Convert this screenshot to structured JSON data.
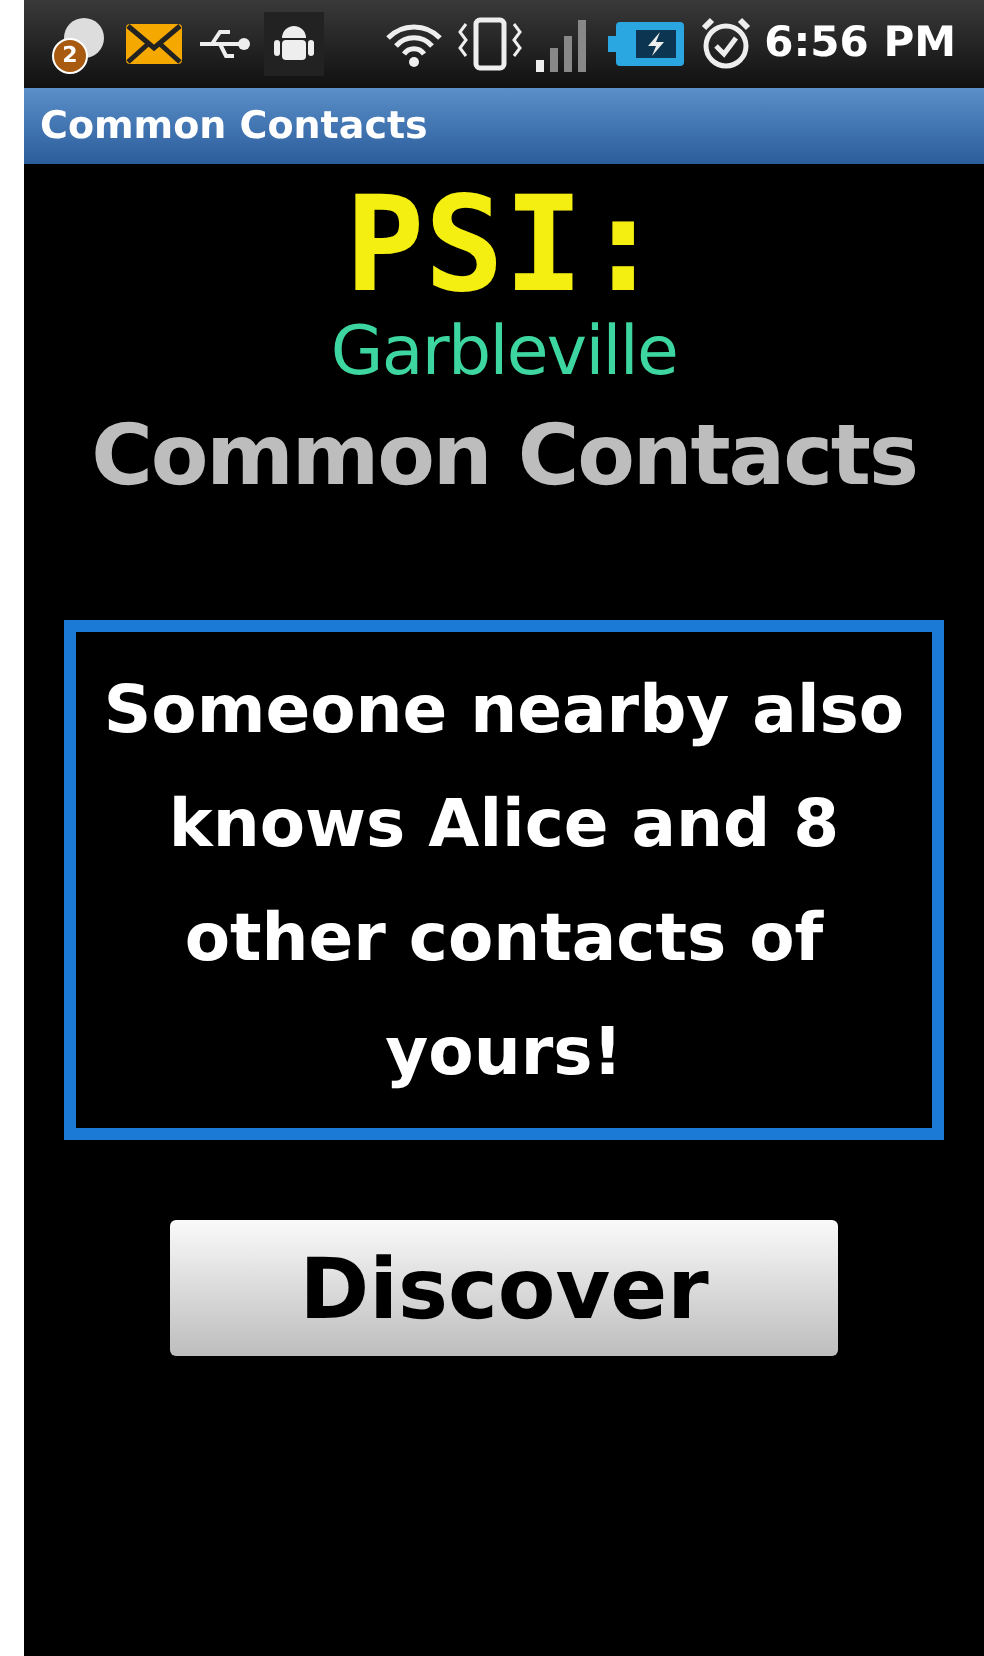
{
  "status_bar": {
    "notification_count": "2",
    "time": "6:56 PM"
  },
  "title_bar": {
    "title": "Common Contacts"
  },
  "logo": {
    "title": "PSI:",
    "subtitle": "Garbleville"
  },
  "heading": "Common Contacts",
  "message": "Someone nearby also knows Alice and 8 other contacts of yours!",
  "button": {
    "label": "Discover"
  }
}
